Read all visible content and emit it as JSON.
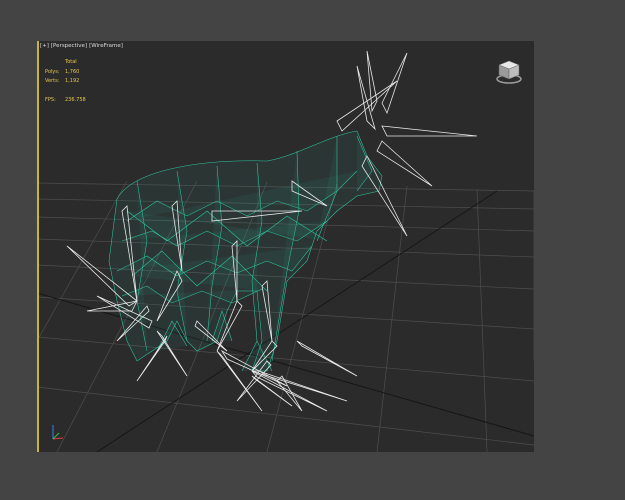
{
  "viewport": {
    "labels": {
      "menu": "[+]",
      "view": "[Perspective]",
      "shading": "[WireFrame]"
    },
    "stats": {
      "header": "Total",
      "polys_label": "Polys:",
      "polys_value": "1,760",
      "verts_label": "Verts:",
      "verts_value": "1,192",
      "fps_label": "FPS:",
      "fps_value": "236.758"
    },
    "icons": {
      "viewcube": "viewcube-icon",
      "axis_tripod": "axis-tripod-icon"
    },
    "colors": {
      "background": "#2b2b2b",
      "grid": "#555555",
      "mesh": "#2fc5a0",
      "bones": "#e8e8e8",
      "stats_text": "#e6c84a",
      "active_border": "#c9b53a"
    }
  }
}
